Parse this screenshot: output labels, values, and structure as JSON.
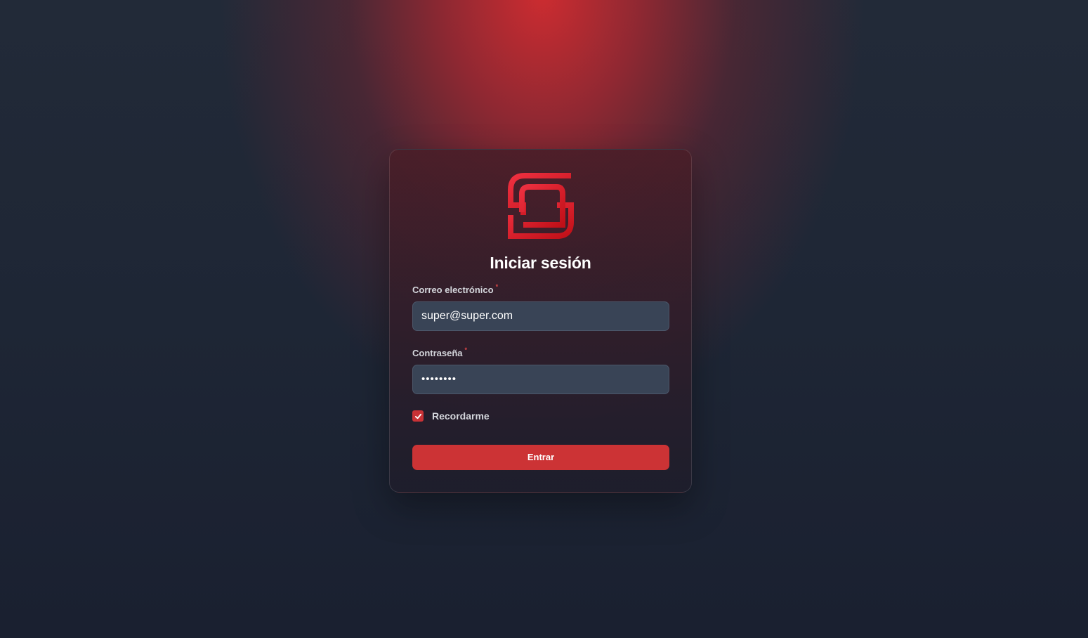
{
  "login": {
    "title": "Iniciar sesión",
    "email": {
      "label": "Correo electrónico",
      "required_mark": "*",
      "value": "super@super.com"
    },
    "password": {
      "label": "Contraseña",
      "required_mark": "*",
      "value": "••••••••"
    },
    "remember": {
      "label": "Recordarme",
      "checked": true
    },
    "submit_label": "Entrar"
  },
  "colors": {
    "accent": "#cc3335",
    "input_bg": "#394456",
    "page_bg": "#1c2332"
  },
  "icons": {
    "logo": "brand-logo-icon",
    "check": "check-icon"
  }
}
